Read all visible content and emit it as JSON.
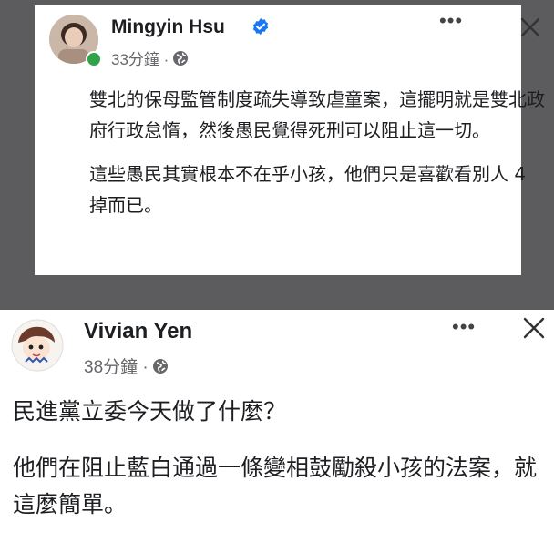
{
  "post1": {
    "author": "Mingyin Hsu",
    "time": "33分鐘 ·",
    "paragraphs": [
      "雙北的保母監管制度疏失導致虐童案，這擺明就是雙北政府行政怠惰，然後愚民覺得死刑可以阻止這一切。",
      "這些愚民其實根本不在乎小孩，他們只是喜歡看別人 4 掉而已。"
    ]
  },
  "post2": {
    "author": "Vivian Yen",
    "time": "38分鐘 ·",
    "paragraphs": [
      "民進黨立委今天做了什麼？",
      "他們在阻止藍白通過一條變相鼓勵殺小孩的法案，就這麼簡單。"
    ]
  },
  "icons": {
    "more": "•••",
    "close": "close-icon",
    "globe": "globe-icon",
    "verified": "verified-badge-icon"
  },
  "colors": {
    "background_dark": "#5c5c5e",
    "verified_blue": "#1877f2",
    "online_green": "#31a24c",
    "meta_gray": "#65676b"
  }
}
